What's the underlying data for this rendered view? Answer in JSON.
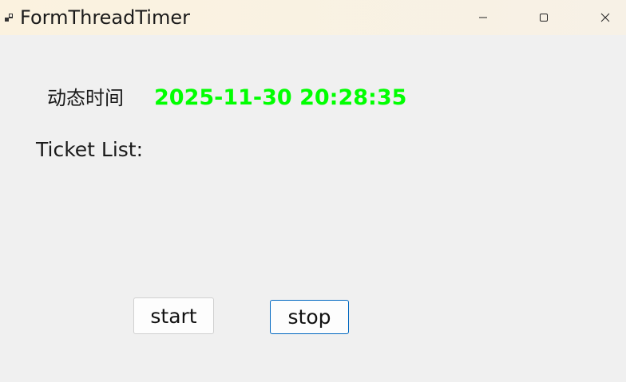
{
  "window": {
    "title": "FormThreadTimer",
    "icon": "app-window-icon",
    "controls": {
      "minimize_icon": "minimize-icon",
      "maximize_icon": "maximize-icon",
      "close_icon": "close-icon"
    }
  },
  "main": {
    "time_label": "动态时间",
    "time_value": "2025-11-30 20:28:35",
    "time_value_color": "#00ff00",
    "ticket_label": "Ticket List:",
    "ticket_items": []
  },
  "buttons": {
    "start_label": "start",
    "stop_label": "stop",
    "focus_color": "#0067c0"
  }
}
